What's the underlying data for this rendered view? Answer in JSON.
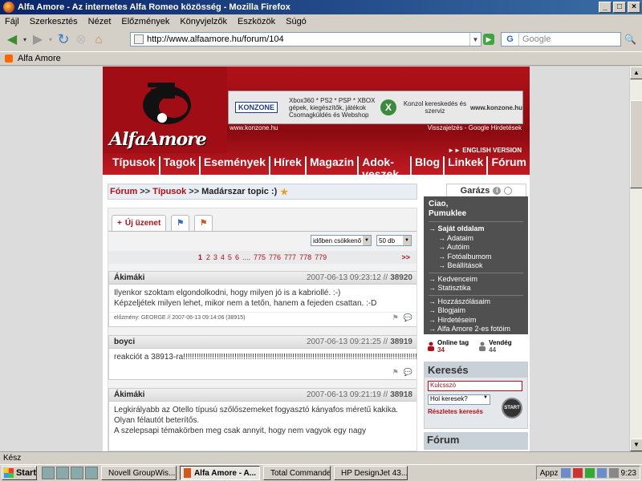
{
  "window": {
    "title": "Alfa Amore - Az internetes Alfa Romeo közösség - Mozilla Firefox",
    "min": "_",
    "max": "□",
    "close": "×"
  },
  "menu": [
    "Fájl",
    "Szerkesztés",
    "Nézet",
    "Előzmények",
    "Könyvjelzők",
    "Eszközök",
    "Súgó"
  ],
  "nav": {
    "url": "http://www.alfaamore.hu/forum/104",
    "search_placeholder": "Google",
    "search_engine": "G"
  },
  "bookmarks": [
    "Alfa Amore"
  ],
  "site": {
    "logo_text": "AlfaAmore",
    "ad": {
      "brand": "KONZONE",
      "text1": "Xbox360 * PS2 * PSP * XBOX gépek, kiegészítők, játékok Csomagküldés és Webshop",
      "text2": "Konzol kereskedés és szerviz",
      "url_small": "www.konzone.hu",
      "url_big": "www.konzone.hu",
      "footer_right": "Visszajelzés - Google Hirdetések"
    },
    "english": "ENGLISH VERSION",
    "menu": [
      "Típusok",
      "Tagok",
      "Események",
      "Hírek",
      "Magazin",
      "Adok-veszek",
      "Blog",
      "Linkek",
      "Fórum"
    ]
  },
  "breadcrumb": {
    "forum": "Fórum",
    "sep": ">>",
    "tipusok": "Típusok",
    "current": "Madárszar topic :)"
  },
  "forum": {
    "new_post": "Új üzenet",
    "sort_select": "időben csökkenő",
    "per_page": "50 db",
    "pages": [
      "1",
      "2",
      "3",
      "4",
      "5",
      "6",
      "....",
      "775",
      "776",
      "777",
      "778",
      "779"
    ],
    "next": ">>",
    "posts": [
      {
        "author": "Ákimáki",
        "date": "2007-06-13 09:23:12 //",
        "num": "38920",
        "lines": [
          "Ilyenkor szoktam elgondolkodni, hogy milyen jó is a kabriollé. :-)",
          "Képzeljétek milyen lehet, mikor nem a tetőn, hanem a fejeden csattan. :-D"
        ],
        "prev": "előzmény: GEORGE // 2007-06-13 09:14:06 (38915)"
      },
      {
        "author": "boyci",
        "date": "2007-06-13 09:21:25 //",
        "num": "38919",
        "lines": [
          "reakciót a 38913-ra!!!!!!!!!!!!!!!!!!!!!!!!!!!!!!!!!!!!!!!!!!!!!!!!!!!!!!!!!!!!!!!!!!!!!!!!!!!!!!!!!!!!!!!!!!!!!!!!!!!!!!!!!!!!"
        ],
        "prev": ""
      },
      {
        "author": "Ákimáki",
        "date": "2007-06-13 09:21:19 //",
        "num": "38918",
        "lines": [
          "Legkirályabb az Otello típusú szőlőszemeket fogyasztó kányafos méretű kakika. Olyan félautót beterítős.",
          "A szelepsapi témakörben meg csak annyit, hogy nem vagyok egy nagy"
        ],
        "prev": ""
      }
    ]
  },
  "garage": {
    "tab": "Garázs",
    "hello1": "Ciao,",
    "hello2": "Pumuklee",
    "own": "Saját oldalam",
    "sub": [
      "Adataim",
      "Autóim",
      "Fotóalbumom",
      "Beállítások"
    ],
    "items1": [
      "Kedvenceim",
      "Statisztika"
    ],
    "items2": [
      "Hozzászólásaim",
      "Blogjaim",
      "Hirdetéseim",
      "Alfa Amore 2-es fotóim"
    ]
  },
  "online": {
    "label1": "Online tag",
    "count1": "34",
    "label2": "Vendég",
    "count2": "44"
  },
  "search": {
    "title": "Keresés",
    "placeholder": "Kulcsszó",
    "where": "Hol keresek?",
    "start": "START",
    "detailed": "Részletes keresés"
  },
  "forumbox": "Fórum",
  "status": "Kész",
  "taskbar": {
    "start": "Start",
    "tasks": [
      "Novell GroupWis...",
      "Alfa Amore - A...",
      "Total Commande...",
      "HP DesignJet 43..."
    ],
    "appz": "Appz",
    "time": "9:23"
  },
  "colors": {
    "brand_red": "#b01119",
    "garage_bg": "#505050"
  }
}
